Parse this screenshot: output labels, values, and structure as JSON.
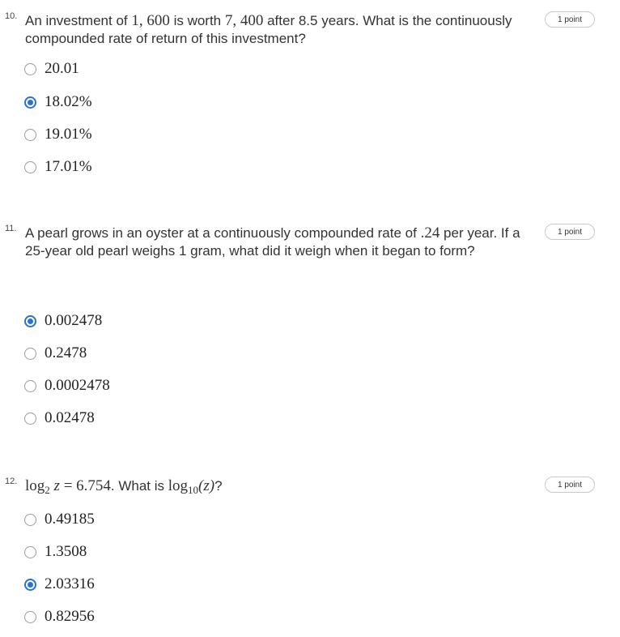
{
  "questions": [
    {
      "number": "10.",
      "points_label": "1 point",
      "text_parts": {
        "a": "An investment of ",
        "m1": "1, 600",
        "b": " is worth ",
        "m2": "7, 400",
        "c": " after 8.5 years. What is the continuously compounded rate of return of this investment?"
      },
      "options": [
        {
          "label": "20.01",
          "selected": false
        },
        {
          "label": "18.02%",
          "selected": true
        },
        {
          "label": "19.01%",
          "selected": false
        },
        {
          "label": "17.01%",
          "selected": false
        }
      ]
    },
    {
      "number": "11.",
      "points_label": "1 point",
      "text_parts": {
        "a": "A pearl grows in an oyster at a continuously compounded rate of ",
        "m1": ".24",
        "b": " per year. If a 25-year old pearl weighs 1 gram, what did it weigh when it began to form?"
      },
      "options": [
        {
          "label": "0.002478",
          "selected": true
        },
        {
          "label": "0.2478",
          "selected": false
        },
        {
          "label": "0.0002478",
          "selected": false
        },
        {
          "label": "0.02478",
          "selected": false
        }
      ]
    },
    {
      "number": "12.",
      "points_label": "1 point",
      "text_parts": {
        "m1_log": "log",
        "m1_base": "2",
        "m1_var": "z",
        "m1_eq": "= 6.754",
        "b": ". What is ",
        "m2_log": "log",
        "m2_base": "10",
        "m2_arg": "(z)",
        "c": "?"
      },
      "options": [
        {
          "label": "0.49185",
          "selected": false
        },
        {
          "label": "1.3508",
          "selected": false
        },
        {
          "label": "2.03316",
          "selected": true
        },
        {
          "label": "0.82956",
          "selected": false
        }
      ]
    }
  ],
  "colors": {
    "accent": "#2a73cc",
    "radio_border": "#9a9a9a",
    "pill_border": "#c9c9c9"
  }
}
